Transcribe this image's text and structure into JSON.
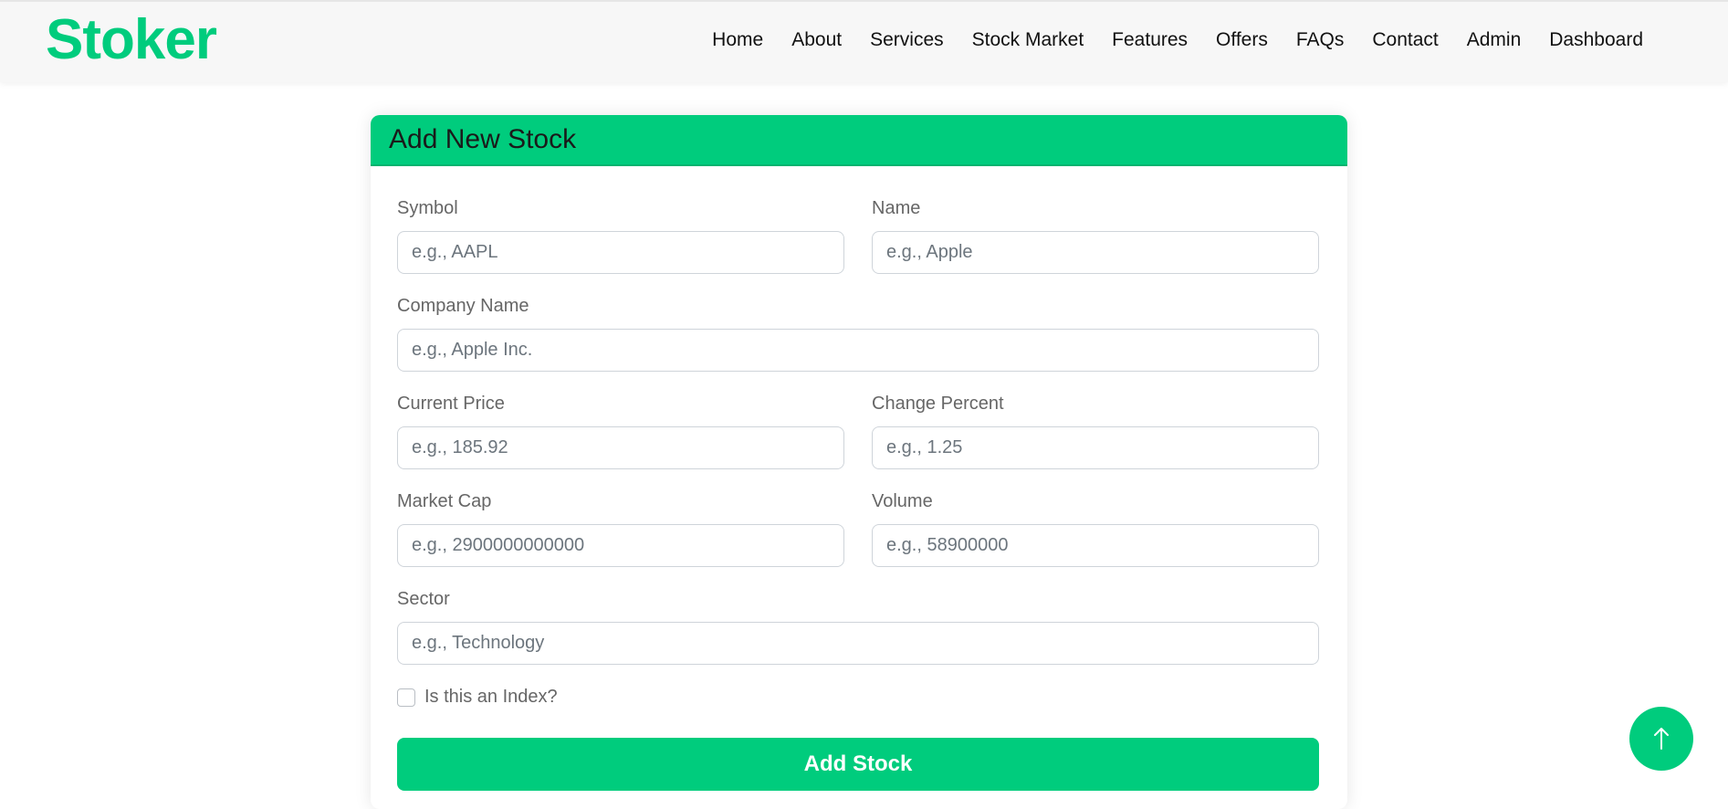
{
  "brand": {
    "name": "Stoker",
    "color": "#00cc7d"
  },
  "nav": {
    "items": [
      "Home",
      "About",
      "Services",
      "Stock Market",
      "Features",
      "Offers",
      "FAQs",
      "Contact",
      "Admin",
      "Dashboard"
    ]
  },
  "form": {
    "title": "Add New Stock",
    "accent_color": "#00cc7d",
    "fields": {
      "symbol": {
        "label": "Symbol",
        "placeholder": "e.g., AAPL",
        "value": ""
      },
      "name": {
        "label": "Name",
        "placeholder": "e.g., Apple",
        "value": ""
      },
      "company_name": {
        "label": "Company Name",
        "placeholder": "e.g., Apple Inc.",
        "value": ""
      },
      "current_price": {
        "label": "Current Price",
        "placeholder": "e.g., 185.92",
        "value": ""
      },
      "change_percent": {
        "label": "Change Percent",
        "placeholder": "e.g., 1.25",
        "value": ""
      },
      "market_cap": {
        "label": "Market Cap",
        "placeholder": "e.g., 2900000000000",
        "value": ""
      },
      "volume": {
        "label": "Volume",
        "placeholder": "e.g., 58900000",
        "value": ""
      },
      "sector": {
        "label": "Sector",
        "placeholder": "e.g., Technology",
        "value": ""
      }
    },
    "is_index": {
      "label": "Is this an Index?",
      "checked": false
    },
    "submit_label": "Add Stock"
  },
  "scroll_top": {
    "icon": "arrow-up-icon"
  }
}
